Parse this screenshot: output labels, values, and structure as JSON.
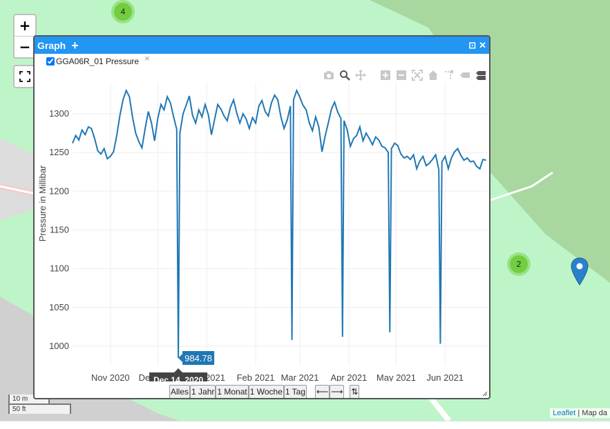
{
  "map": {
    "zoom_in": "+",
    "zoom_out": "−",
    "clusters": [
      {
        "count": "4"
      },
      {
        "count": "2"
      }
    ],
    "scale_m": "10 m",
    "scale_ft": "50 ft",
    "attribution_link": "Leaflet",
    "attribution_rest": "| Map da"
  },
  "dialog": {
    "title": "Graph",
    "add": "+",
    "minimize_icon": "⊡",
    "close_icon": "✕",
    "series_label": "GGA06R_01 Pressure",
    "remove_series": "×",
    "range_buttons": [
      "Alles",
      "1 Jahr",
      "1 Monat",
      "1 Woche",
      "1 Tag"
    ],
    "nav_prev": "⟵",
    "nav_next": "⟶",
    "sort_toggle": "⇅"
  },
  "chart_data": {
    "type": "line",
    "ylabel": "Pressure in Millibar",
    "xlabel": "",
    "ylim": [
      975,
      1340
    ],
    "yticks": [
      1000,
      1050,
      1100,
      1150,
      1200,
      1250,
      1300
    ],
    "xlim": [
      "2020-10-08",
      "2021-06-28"
    ],
    "xticks": [
      {
        "label": "Nov 2020",
        "date": "2020-11-01"
      },
      {
        "label": "Dec 2020",
        "date": "2020-12-01"
      },
      {
        "label": "Jan 2021",
        "date": "2021-01-01"
      },
      {
        "label": "Feb 2021",
        "date": "2021-02-01"
      },
      {
        "label": "Mar 2021",
        "date": "2021-03-01"
      },
      {
        "label": "Apr 2021",
        "date": "2021-04-01"
      },
      {
        "label": "May 2021",
        "date": "2021-05-01"
      },
      {
        "label": "Jun 2021",
        "date": "2021-06-01"
      }
    ],
    "series": [
      {
        "name": "GGA06R_01 Pressure",
        "color": "#1f77b4",
        "points": [
          [
            "2020-10-08",
            1262
          ],
          [
            "2020-10-10",
            1272
          ],
          [
            "2020-10-12",
            1266
          ],
          [
            "2020-10-14",
            1279
          ],
          [
            "2020-10-16",
            1273
          ],
          [
            "2020-10-18",
            1283
          ],
          [
            "2020-10-20",
            1281
          ],
          [
            "2020-10-22",
            1268
          ],
          [
            "2020-10-24",
            1252
          ],
          [
            "2020-10-26",
            1248
          ],
          [
            "2020-10-28",
            1255
          ],
          [
            "2020-10-30",
            1242
          ],
          [
            "2020-11-01",
            1245
          ],
          [
            "2020-11-03",
            1251
          ],
          [
            "2020-11-05",
            1272
          ],
          [
            "2020-11-07",
            1298
          ],
          [
            "2020-11-09",
            1318
          ],
          [
            "2020-11-11",
            1330
          ],
          [
            "2020-11-13",
            1322
          ],
          [
            "2020-11-15",
            1296
          ],
          [
            "2020-11-17",
            1275
          ],
          [
            "2020-11-19",
            1264
          ],
          [
            "2020-11-21",
            1256
          ],
          [
            "2020-11-23",
            1281
          ],
          [
            "2020-11-25",
            1303
          ],
          [
            "2020-11-27",
            1288
          ],
          [
            "2020-11-29",
            1265
          ],
          [
            "2020-12-01",
            1294
          ],
          [
            "2020-12-03",
            1312
          ],
          [
            "2020-12-05",
            1305
          ],
          [
            "2020-12-07",
            1322
          ],
          [
            "2020-12-09",
            1314
          ],
          [
            "2020-12-11",
            1296
          ],
          [
            "2020-12-13",
            1280
          ],
          [
            "2020-12-14",
            984.78
          ],
          [
            "2020-12-15",
            1275
          ],
          [
            "2020-12-17",
            1300
          ],
          [
            "2020-12-19",
            1311
          ],
          [
            "2020-12-21",
            1323
          ],
          [
            "2020-12-23",
            1298
          ],
          [
            "2020-12-25",
            1288
          ],
          [
            "2020-12-27",
            1305
          ],
          [
            "2020-12-29",
            1296
          ],
          [
            "2020-12-31",
            1312
          ],
          [
            "2021-01-02",
            1299
          ],
          [
            "2021-01-04",
            1273
          ],
          [
            "2021-01-06",
            1293
          ],
          [
            "2021-01-08",
            1312
          ],
          [
            "2021-01-10",
            1306
          ],
          [
            "2021-01-12",
            1297
          ],
          [
            "2021-01-14",
            1291
          ],
          [
            "2021-01-16",
            1308
          ],
          [
            "2021-01-18",
            1318
          ],
          [
            "2021-01-20",
            1301
          ],
          [
            "2021-01-22",
            1288
          ],
          [
            "2021-01-24",
            1300
          ],
          [
            "2021-01-26",
            1293
          ],
          [
            "2021-01-28",
            1281
          ],
          [
            "2021-01-30",
            1295
          ],
          [
            "2021-02-01",
            1288
          ],
          [
            "2021-02-03",
            1310
          ],
          [
            "2021-02-05",
            1317
          ],
          [
            "2021-02-07",
            1303
          ],
          [
            "2021-02-09",
            1297
          ],
          [
            "2021-02-11",
            1314
          ],
          [
            "2021-02-13",
            1324
          ],
          [
            "2021-02-15",
            1318
          ],
          [
            "2021-02-17",
            1296
          ],
          [
            "2021-02-19",
            1281
          ],
          [
            "2021-02-21",
            1292
          ],
          [
            "2021-02-23",
            1310
          ],
          [
            "2021-02-24",
            1008
          ],
          [
            "2021-02-25",
            1318
          ],
          [
            "2021-02-27",
            1330
          ],
          [
            "2021-03-01",
            1321
          ],
          [
            "2021-03-03",
            1311
          ],
          [
            "2021-03-05",
            1305
          ],
          [
            "2021-03-07",
            1288
          ],
          [
            "2021-03-09",
            1278
          ],
          [
            "2021-03-11",
            1296
          ],
          [
            "2021-03-13",
            1283
          ],
          [
            "2021-03-15",
            1251
          ],
          [
            "2021-03-17",
            1271
          ],
          [
            "2021-03-19",
            1288
          ],
          [
            "2021-03-21",
            1306
          ],
          [
            "2021-03-23",
            1315
          ],
          [
            "2021-03-25",
            1302
          ],
          [
            "2021-03-27",
            1294
          ],
          [
            "2021-03-28",
            1012
          ],
          [
            "2021-03-29",
            1291
          ],
          [
            "2021-03-31",
            1279
          ],
          [
            "2021-04-02",
            1258
          ],
          [
            "2021-04-04",
            1268
          ],
          [
            "2021-04-06",
            1272
          ],
          [
            "2021-04-08",
            1283
          ],
          [
            "2021-04-10",
            1265
          ],
          [
            "2021-04-12",
            1275
          ],
          [
            "2021-04-14",
            1268
          ],
          [
            "2021-04-16",
            1260
          ],
          [
            "2021-04-18",
            1270
          ],
          [
            "2021-04-20",
            1266
          ],
          [
            "2021-04-22",
            1258
          ],
          [
            "2021-04-24",
            1256
          ],
          [
            "2021-04-26",
            1250
          ],
          [
            "2021-04-27",
            1018
          ],
          [
            "2021-04-28",
            1255
          ],
          [
            "2021-04-30",
            1262
          ],
          [
            "2021-05-02",
            1259
          ],
          [
            "2021-05-04",
            1248
          ],
          [
            "2021-05-06",
            1243
          ],
          [
            "2021-05-08",
            1245
          ],
          [
            "2021-05-10",
            1241
          ],
          [
            "2021-05-12",
            1247
          ],
          [
            "2021-05-14",
            1229
          ],
          [
            "2021-05-16",
            1239
          ],
          [
            "2021-05-18",
            1245
          ],
          [
            "2021-05-20",
            1233
          ],
          [
            "2021-05-22",
            1236
          ],
          [
            "2021-05-24",
            1241
          ],
          [
            "2021-05-26",
            1247
          ],
          [
            "2021-05-28",
            1228
          ],
          [
            "2021-05-29",
            1003
          ],
          [
            "2021-05-30",
            1238
          ],
          [
            "2021-06-01",
            1245
          ],
          [
            "2021-06-03",
            1229
          ],
          [
            "2021-06-05",
            1243
          ],
          [
            "2021-06-07",
            1251
          ],
          [
            "2021-06-09",
            1255
          ],
          [
            "2021-06-11",
            1246
          ],
          [
            "2021-06-13",
            1240
          ],
          [
            "2021-06-15",
            1243
          ],
          [
            "2021-06-17",
            1238
          ],
          [
            "2021-06-19",
            1239
          ],
          [
            "2021-06-21",
            1232
          ],
          [
            "2021-06-23",
            1229
          ],
          [
            "2021-06-25",
            1241
          ],
          [
            "2021-06-27",
            1240
          ]
        ]
      }
    ],
    "hover": {
      "value": "984.78",
      "date_label": "Dec 14, 2020"
    }
  },
  "modebar": [
    "camera-icon",
    "zoom-icon",
    "pan-icon",
    "zoom-in-icon",
    "zoom-out-icon",
    "autoscale-icon",
    "reset-axes-icon",
    "spike-lines-icon",
    "hover-closest-icon",
    "hover-compare-icon"
  ]
}
